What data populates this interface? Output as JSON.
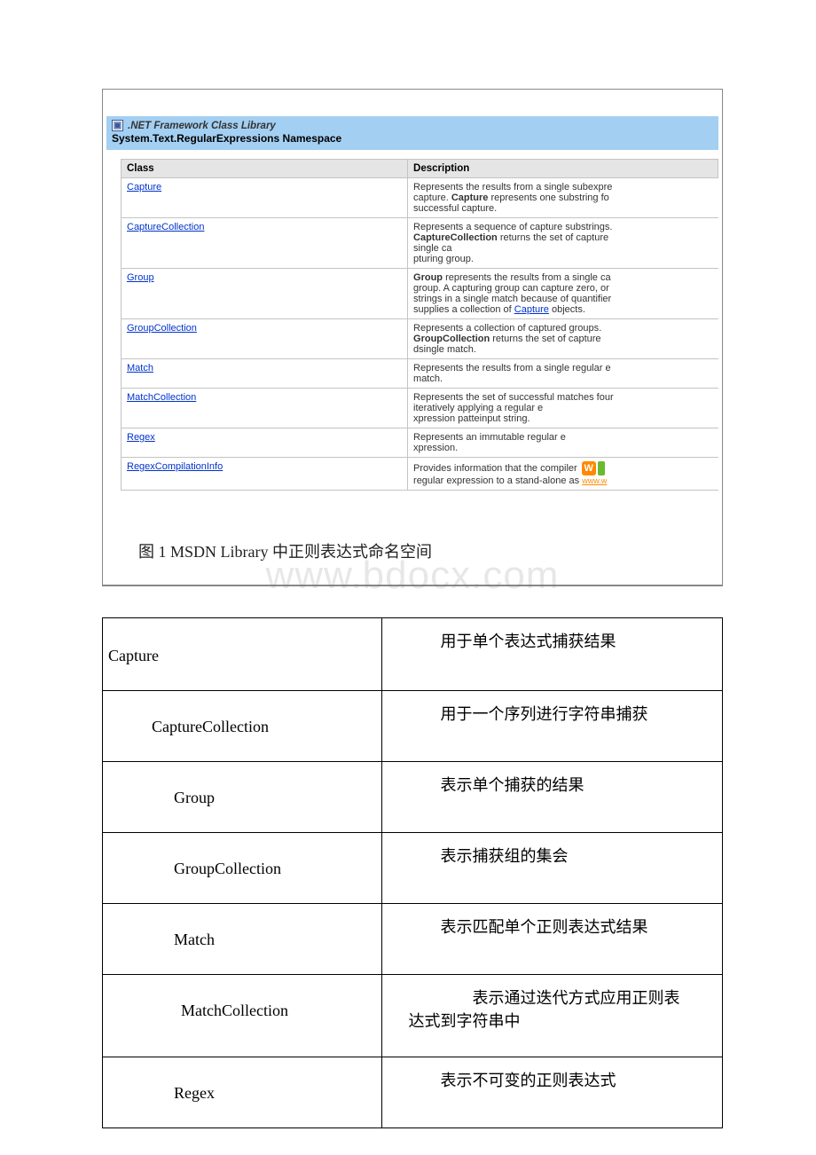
{
  "header": {
    "library": ".NET Framework Class Library",
    "namespace": "System.Text.RegularExpressions Namespace"
  },
  "table_headers": {
    "class": "Class",
    "description": "Description"
  },
  "rows": [
    {
      "class": "Capture",
      "desc_parts": [
        "Represents the results from a single subexpre",
        "capture. ",
        "Capture",
        " represents one substring fo",
        "successful capture."
      ]
    },
    {
      "class": "CaptureCollection",
      "desc_parts": [
        "Represents a sequence of capture substrings.",
        "CaptureCollection",
        " returns the set of capture",
        "single capturing group."
      ]
    },
    {
      "class": "Group",
      "desc_parts": [
        "Group",
        " represents the results from a single ca",
        "group. A capturing group can capture zero, or",
        "strings in a single match because of quantifier",
        "supplies a collection of ",
        "Capture",
        " objects."
      ]
    },
    {
      "class": "GroupCollection",
      "desc_parts": [
        "Represents a collection of captured groups.",
        "GroupCollection",
        " returns the set of captured",
        "single match."
      ]
    },
    {
      "class": "Match",
      "desc_parts": [
        "Represents the results from a single regular e",
        "match."
      ]
    },
    {
      "class": "MatchCollection",
      "desc_parts": [
        "Represents the set of successful matches four",
        "iteratively applying a regular expression patte",
        "input string."
      ]
    },
    {
      "class": "Regex",
      "desc_parts": [
        "Represents an immutable regular expression."
      ]
    },
    {
      "class": "RegexCompilationInfo",
      "desc_parts": [
        "Provides information that the compiler",
        "regular expression to a stand-alone as"
      ],
      "has_badge": true,
      "badge_text": "W",
      "badge_link": "www.w"
    }
  ],
  "caption": "图 1 MSDN Library 中正则表达式命名空间",
  "watermark": "www.bdocx.com",
  "cn_rows": [
    {
      "name": "Capture",
      "indent": "",
      "desc": "用于单个表达式捕获结果"
    },
    {
      "name": "CaptureCollection",
      "indent": "indent1",
      "desc": "用于一个序列进行字符串捕获"
    },
    {
      "name": "Group",
      "indent": "indent2",
      "desc": "表示单个捕获的结果"
    },
    {
      "name": "GroupCollection",
      "indent": "indent2",
      "desc": "表示捕获组的集会"
    },
    {
      "name": "Match",
      "indent": "indent2",
      "desc": "表示匹配单个正则表达式结果"
    },
    {
      "name": "MatchCollection",
      "indent": "indent3",
      "desc": "表示通过迭代方式应用正则表达式到字符串中",
      "multiline": true
    },
    {
      "name": "Regex",
      "indent": "indent2",
      "desc": "表示不可变的正则表达式"
    }
  ]
}
